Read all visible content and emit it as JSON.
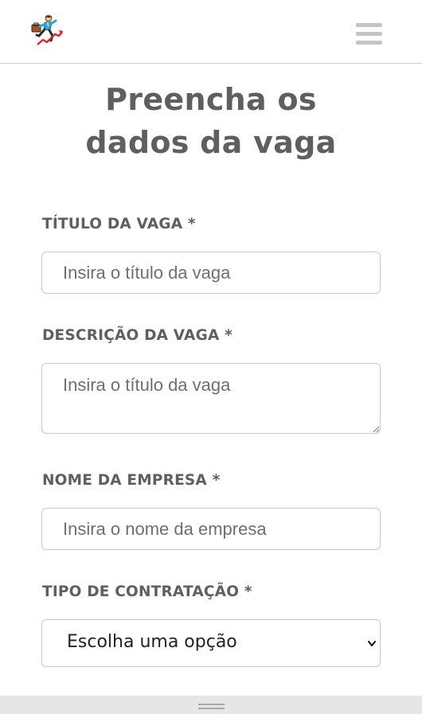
{
  "header": {
    "logo_icon": "running-businessman-chart-icon",
    "menu_icon": "hamburger-menu-icon"
  },
  "page": {
    "title_line1": "Preencha os",
    "title_line2": "dados da vaga"
  },
  "form": {
    "job_title": {
      "label": "TÍTULO DA VAGA *",
      "placeholder": "Insira o título da vaga",
      "value": ""
    },
    "job_description": {
      "label": "DESCRIÇÃO DA VAGA *",
      "placeholder": "Insira o título da vaga",
      "value": ""
    },
    "company_name": {
      "label": "NOME DA EMPRESA *",
      "placeholder": "Insira o nome da empresa",
      "value": ""
    },
    "contract_type": {
      "label": "TIPO DE CONTRATAÇÃO *",
      "selected": "Escolha uma opção",
      "icon": "chevron-down-icon"
    }
  },
  "colors": {
    "text_heading": "#5f5f5f",
    "border": "#c9c9c9",
    "bottom_bar": "#e6e6e6"
  }
}
